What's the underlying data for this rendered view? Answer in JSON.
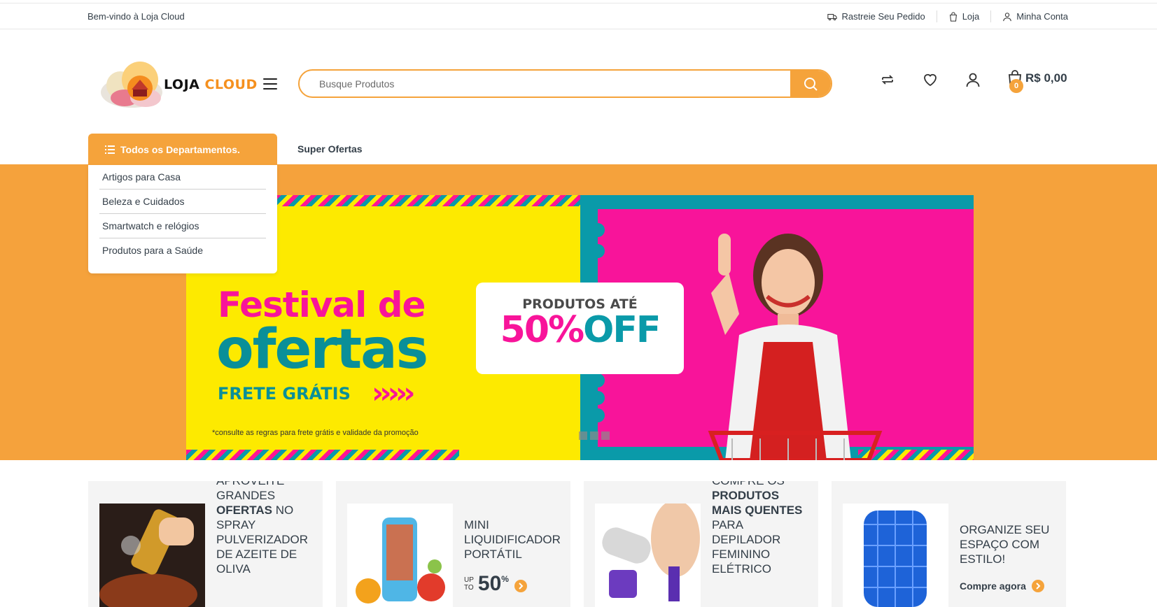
{
  "topbar": {
    "welcome": "Bem-vindo à Loja Cloud",
    "track": "Rastreie Seu Pedido",
    "shop": "Loja",
    "account": "Minha Conta"
  },
  "header": {
    "logo_part1": "LOJA",
    "logo_part2": "CLOUD",
    "search_placeholder": "Busque Produtos",
    "cart_count": "0",
    "cart_total": "R$ 0,00",
    "icons": [
      "compare-icon",
      "heart-icon",
      "user-icon",
      "cart-icon"
    ]
  },
  "nav": {
    "departments_label": "Todos os Departamentos.",
    "super_ofertas": "Super Ofertas",
    "departments": [
      "Artigos para Casa",
      "Beleza e Cuidados",
      "Smartwatch e relógios",
      "Produtos para a Saúde"
    ]
  },
  "banner": {
    "line1": "Festival de",
    "line2": "ofertas",
    "frete": "FRETE GRÁTIS",
    "fine_print": "*consulte as regras para frete grátis e validade da promoção",
    "promo_top": "PRODUTOS ATÉ",
    "promo_percent": "50%",
    "promo_off": "OFF"
  },
  "cards": [
    {
      "pre": "APROVEITE GRANDES ",
      "bold": "OFERTAS",
      "post": " NO SPRAY PULVERIZADOR DE AZEITE DE OLIVA"
    },
    {
      "title": "MINI LIQUIDIFICADOR PORTÁTIL",
      "up": "UP",
      "to": "TO",
      "value": "50",
      "pct": "%"
    },
    {
      "pre": "COMPRE OS ",
      "bold": "PRODUTOS MAIS QUENTES",
      "post": " PARA DEPILADOR FEMININO ELÉTRICO"
    },
    {
      "title": "ORGANIZE SEU ESPAÇO COM ESTILO!",
      "cta": "Compre agora"
    }
  ],
  "colors": {
    "accent": "#f5a33b",
    "hero_bg": "#f5a23c",
    "pink": "#f8149a",
    "teal": "#0a9aa9",
    "yellow": "#fdea00"
  }
}
